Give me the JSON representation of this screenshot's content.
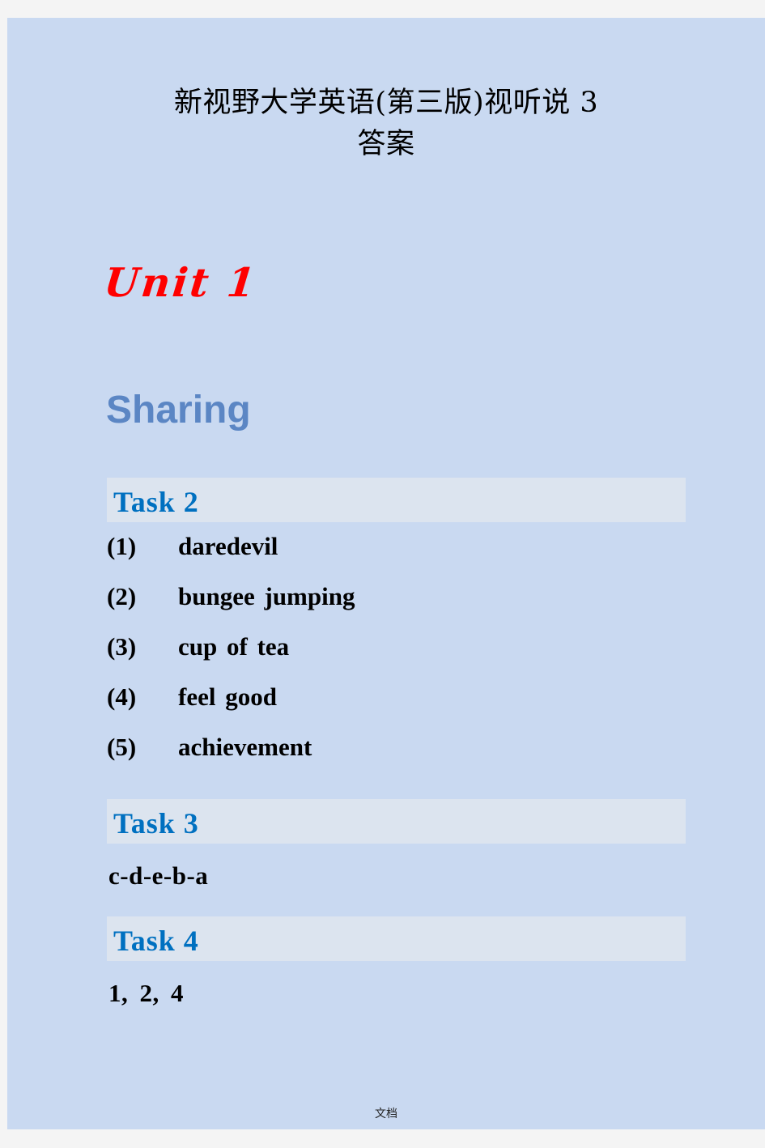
{
  "document": {
    "title_line1": "新视野大学英语(第三版)视听说 3",
    "title_line2": "答案",
    "footer_text": "文档",
    "page_background": "#c9d9f1",
    "canvas_background": "#f4f4f4"
  },
  "unit": {
    "label": "Unit 1",
    "color": "#ff0000"
  },
  "section": {
    "label": "Sharing",
    "color": "#5b86c4"
  },
  "tasks": [
    {
      "label": "Task  2",
      "bar_color": "#dce4ef",
      "label_color": "#0070c0",
      "answer_type": "numbered-list",
      "items": [
        {
          "num": "(1)",
          "text": "daredevil"
        },
        {
          "num": "(2)",
          "text": "bungee  jumping"
        },
        {
          "num": "(3)",
          "text": "cup  of  tea"
        },
        {
          "num": "(4)",
          "text": "feel  good"
        },
        {
          "num": "(5)",
          "text": "achievement"
        }
      ]
    },
    {
      "label": "Task  3",
      "bar_color": "#dce4ef",
      "label_color": "#0070c0",
      "answer_type": "single-line",
      "answer": "c-d-e-b-a"
    },
    {
      "label": "Task  4",
      "bar_color": "#dce4ef",
      "label_color": "#0070c0",
      "answer_type": "single-line",
      "answer": "1,  2,  4"
    }
  ]
}
